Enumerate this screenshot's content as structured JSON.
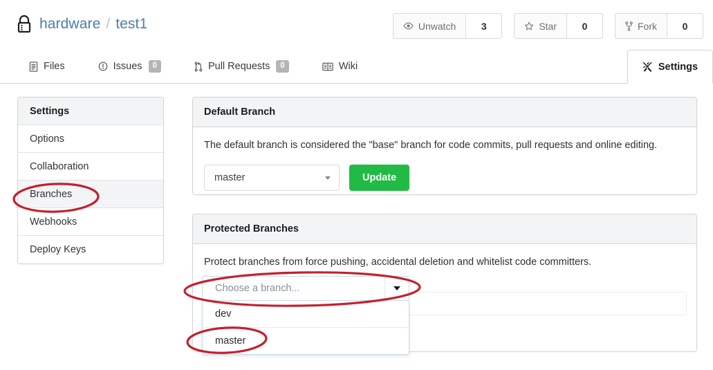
{
  "repo": {
    "visibility_icon": "lock-icon",
    "owner": "hardware",
    "separator": "/",
    "name": "test1"
  },
  "repo_actions": [
    {
      "icon": "eye-icon",
      "label": "Unwatch",
      "count": "3",
      "name": "watch-button"
    },
    {
      "icon": "star-icon",
      "label": "Star",
      "count": "0",
      "name": "star-button"
    },
    {
      "icon": "fork-icon",
      "label": "Fork",
      "count": "0",
      "name": "fork-button"
    }
  ],
  "nav": {
    "items": [
      {
        "icon": "file-text-icon",
        "label": "Files",
        "badge": null,
        "active": false
      },
      {
        "icon": "issue-opened-icon",
        "label": "Issues",
        "badge": "0",
        "active": false
      },
      {
        "icon": "git-pull-request-icon",
        "label": "Pull Requests",
        "badge": "0",
        "active": false
      },
      {
        "icon": "book-icon",
        "label": "Wiki",
        "badge": null,
        "active": false
      }
    ],
    "settings": {
      "icon": "tools-icon",
      "label": "Settings",
      "active": true
    }
  },
  "sidebar": {
    "header": "Settings",
    "items": [
      {
        "label": "Options",
        "active": false
      },
      {
        "label": "Collaboration",
        "active": false
      },
      {
        "label": "Branches",
        "active": true
      },
      {
        "label": "Webhooks",
        "active": false
      },
      {
        "label": "Deploy Keys",
        "active": false
      }
    ]
  },
  "default_branch_panel": {
    "title": "Default Branch",
    "description": "The default branch is considered the \"base\" branch for code commits, pull requests and online editing.",
    "select_value": "master",
    "update_label": "Update"
  },
  "protected_branches_panel": {
    "title": "Protected Branches",
    "description": "Protect branches from force pushing, accidental deletion and whitelist code committers.",
    "dropdown_placeholder": "Choose a branch...",
    "dropdown_open": true,
    "options": [
      {
        "label": "dev"
      },
      {
        "label": "master"
      }
    ]
  },
  "annotations": {
    "color": "#c4202e",
    "targets": [
      "sidebar-item-branches",
      "branch-dropdown-trigger",
      "branch-option-master"
    ]
  },
  "colors": {
    "link": "#4a7dae",
    "green_button": "#21ba45",
    "panel_header_bg": "#f3f4f5",
    "border": "#d4d4d5",
    "annotation_red": "#c4202e"
  }
}
